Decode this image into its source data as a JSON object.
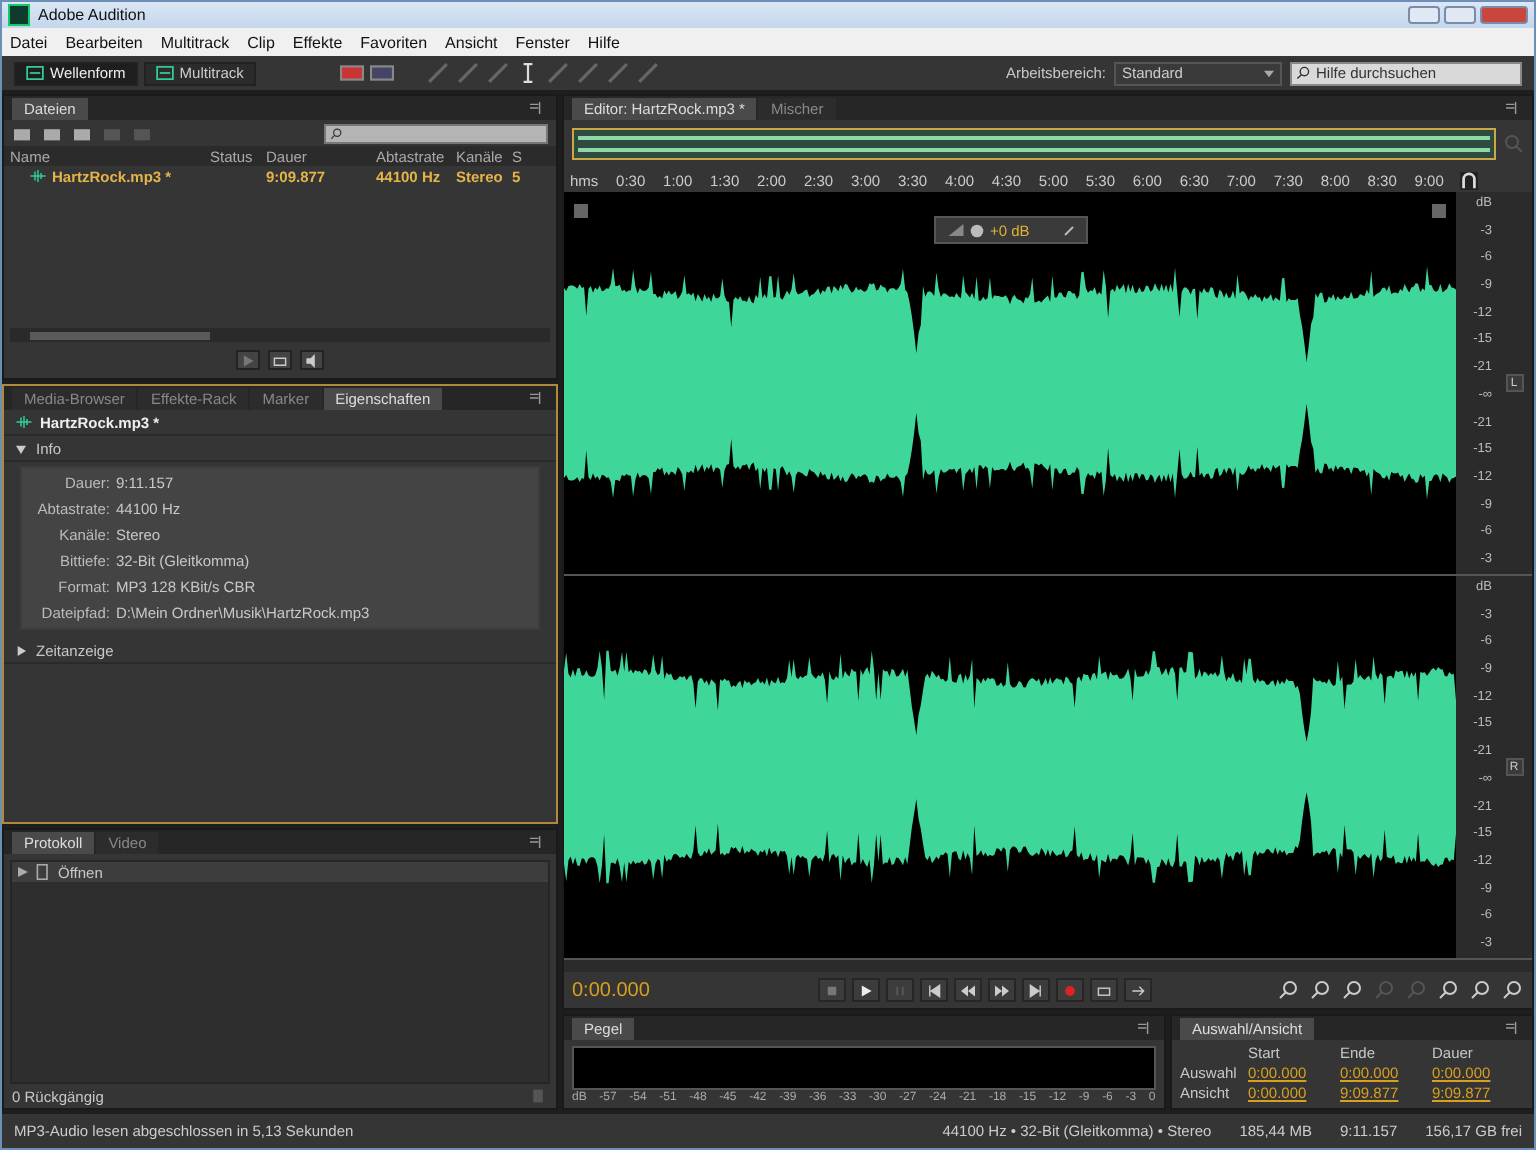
{
  "window": {
    "title": "Adobe Audition"
  },
  "menu": [
    "Datei",
    "Bearbeiten",
    "Multitrack",
    "Clip",
    "Effekte",
    "Favoriten",
    "Ansicht",
    "Fenster",
    "Hilfe"
  ],
  "toolbar": {
    "modes": [
      {
        "label": "Wellenform",
        "selected": true
      },
      {
        "label": "Multitrack",
        "selected": false
      }
    ],
    "workspace_label": "Arbeitsbereich:",
    "workspace_value": "Standard",
    "help_search": {
      "placeholder": "Hilfe durchsuchen"
    }
  },
  "files_panel": {
    "tab": "Dateien",
    "columns": [
      "Name",
      "Status",
      "Dauer",
      "Abtastrate",
      "Kanäle",
      "S"
    ],
    "rows": [
      {
        "name": "HartzRock.mp3 *",
        "status": "",
        "duration": "9:09.877",
        "sample_rate": "44100 Hz",
        "channels": "Stereo",
        "column_6": "5"
      }
    ]
  },
  "properties_panel": {
    "tabs": [
      {
        "label": "Media-Browser",
        "selected": false
      },
      {
        "label": "Effekte-Rack",
        "selected": false
      },
      {
        "label": "Marker",
        "selected": false
      },
      {
        "label": "Eigenschaften",
        "selected": true
      }
    ],
    "file": "HartzRock.mp3 *",
    "sections": [
      {
        "title": "Info",
        "expanded": true,
        "fields": [
          {
            "label": "Dauer:",
            "value": "9:11.157"
          },
          {
            "label": "Abtastrate:",
            "value": "44100 Hz"
          },
          {
            "label": "Kanäle:",
            "value": "Stereo"
          },
          {
            "label": "Bittiefe:",
            "value": "32-Bit (Gleitkomma)"
          },
          {
            "label": "Format:",
            "value": "MP3 128 KBit/s CBR"
          },
          {
            "label": "Dateipfad:",
            "value": "D:\\Mein Ordner\\Musik\\HartzRock.mp3"
          }
        ]
      },
      {
        "title": "Zeitanzeige",
        "expanded": false
      }
    ]
  },
  "history_panel": {
    "tabs": [
      {
        "label": "Protokoll",
        "selected": true
      },
      {
        "label": "Video",
        "selected": false
      }
    ],
    "items": [
      {
        "label": "Öffnen"
      }
    ],
    "footer": "0 Rückgängig"
  },
  "editor": {
    "tabs": [
      {
        "label": "Editor: HartzRock.mp3 *",
        "selected": true
      },
      {
        "label": "Mischer",
        "selected": false
      }
    ],
    "ruler": [
      "hms",
      "0:30",
      "1:00",
      "1:30",
      "2:00",
      "2:30",
      "3:00",
      "3:30",
      "4:00",
      "4:30",
      "5:00",
      "5:30",
      "6:00",
      "6:30",
      "7:00",
      "7:30",
      "8:00",
      "8:30",
      "9:00"
    ],
    "gain": "+0 dB",
    "channels": [
      {
        "label": "L",
        "scale": [
          "dB",
          "-3",
          "-6",
          "-9",
          "-12",
          "-15",
          "-21",
          "-∞",
          "-21",
          "-15",
          "-12",
          "-9",
          "-6",
          "-3"
        ]
      },
      {
        "label": "R",
        "scale": [
          "dB",
          "-3",
          "-6",
          "-9",
          "-12",
          "-15",
          "-21",
          "-∞",
          "-21",
          "-15",
          "-12",
          "-9",
          "-6",
          "-3"
        ]
      }
    ],
    "time": "0:00.000"
  },
  "levels_panel": {
    "tab": "Pegel",
    "scale": [
      "dB",
      "-57",
      "-54",
      "-51",
      "-48",
      "-45",
      "-42",
      "-39",
      "-36",
      "-33",
      "-30",
      "-27",
      "-24",
      "-21",
      "-18",
      "-15",
      "-12",
      "-9",
      "-6",
      "-3",
      "0"
    ]
  },
  "selection_panel": {
    "tab": "Auswahl/Ansicht",
    "columns": [
      "Start",
      "Ende",
      "Dauer"
    ],
    "rows": [
      {
        "label": "Auswahl",
        "values": [
          "0:00.000",
          "0:00.000",
          "0:00.000"
        ]
      },
      {
        "label": "Ansicht",
        "values": [
          "0:00.000",
          "9:09.877",
          "9:09.877"
        ]
      }
    ]
  },
  "status_bar": {
    "message": "MP3-Audio lesen abgeschlossen in 5,13 Sekunden",
    "fields": [
      "44100 Hz • 32-Bit (Gleitkomma) • Stereo",
      "185,44 MB",
      "9:11.157",
      "156,17 GB frei"
    ]
  }
}
